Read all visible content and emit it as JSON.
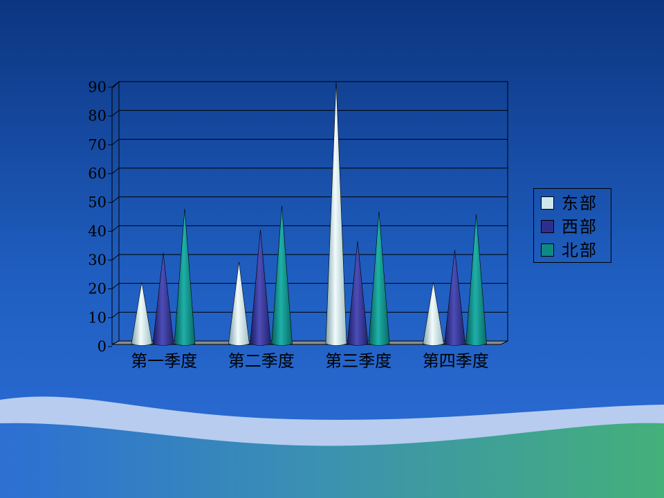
{
  "chart_data": {
    "type": "bar",
    "style": "3d-cone",
    "categories": [
      "第一季度",
      "第二季度",
      "第三季度",
      "第四季度"
    ],
    "series": [
      {
        "name": "东部",
        "values": [
          20.4,
          27.4,
          90,
          20.4
        ],
        "color": "#cfe8ec"
      },
      {
        "name": "西部",
        "values": [
          30.6,
          38.6,
          34.6,
          31.6
        ],
        "color": "#2e2e8f"
      },
      {
        "name": "北部",
        "values": [
          45.9,
          46.9,
          45,
          43.9
        ],
        "color": "#0e8a84"
      }
    ],
    "ylim": [
      0,
      90
    ],
    "yticks": [
      0,
      10,
      20,
      30,
      40,
      50,
      60,
      70,
      80,
      90
    ],
    "grid": true,
    "legend_position": "right"
  },
  "colors": {
    "background_top": "#0d3b8a",
    "background_bottom": "#2a6fd8",
    "wave_light": "#b9cdf0",
    "wave_green": "#3fae80"
  }
}
